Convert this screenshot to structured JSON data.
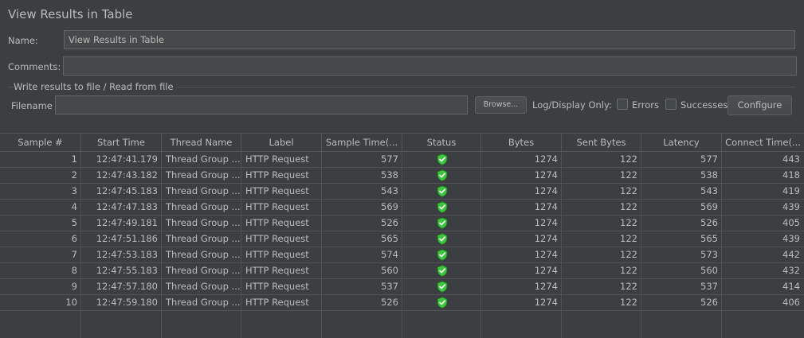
{
  "panel": {
    "title": "View Results in Table",
    "name_label": "Name:",
    "name_value": "View Results in Table",
    "comments_label": "Comments:",
    "comments_value": ""
  },
  "file_group": {
    "title": "Write results to file / Read from file",
    "filename_label": "Filename",
    "filename_value": "",
    "browse_label": "Browse...",
    "log_display_label": "Log/Display Only:",
    "errors_label": "Errors",
    "errors_checked": false,
    "successes_label": "Successes",
    "successes_checked": false,
    "configure_label": "Configure"
  },
  "table": {
    "columns": [
      "Sample #",
      "Start Time",
      "Thread Name",
      "Label",
      "Sample Time(...",
      "Status",
      "Bytes",
      "Sent Bytes",
      "Latency",
      "Connect Time(..."
    ],
    "rows": [
      {
        "sample": "1",
        "start": "12:47:41.179",
        "thread": "Thread Group ...",
        "label": "HTTP Request",
        "sample_time": "577",
        "status": "success",
        "bytes": "1274",
        "sent": "122",
        "latency": "577",
        "connect": "443"
      },
      {
        "sample": "2",
        "start": "12:47:43.182",
        "thread": "Thread Group ...",
        "label": "HTTP Request",
        "sample_time": "538",
        "status": "success",
        "bytes": "1274",
        "sent": "122",
        "latency": "538",
        "connect": "418"
      },
      {
        "sample": "3",
        "start": "12:47:45.183",
        "thread": "Thread Group ...",
        "label": "HTTP Request",
        "sample_time": "543",
        "status": "success",
        "bytes": "1274",
        "sent": "122",
        "latency": "543",
        "connect": "419"
      },
      {
        "sample": "4",
        "start": "12:47:47.183",
        "thread": "Thread Group ...",
        "label": "HTTP Request",
        "sample_time": "569",
        "status": "success",
        "bytes": "1274",
        "sent": "122",
        "latency": "569",
        "connect": "439"
      },
      {
        "sample": "5",
        "start": "12:47:49.181",
        "thread": "Thread Group ...",
        "label": "HTTP Request",
        "sample_time": "526",
        "status": "success",
        "bytes": "1274",
        "sent": "122",
        "latency": "526",
        "connect": "405"
      },
      {
        "sample": "6",
        "start": "12:47:51.186",
        "thread": "Thread Group ...",
        "label": "HTTP Request",
        "sample_time": "565",
        "status": "success",
        "bytes": "1274",
        "sent": "122",
        "latency": "565",
        "connect": "439"
      },
      {
        "sample": "7",
        "start": "12:47:53.183",
        "thread": "Thread Group ...",
        "label": "HTTP Request",
        "sample_time": "574",
        "status": "success",
        "bytes": "1274",
        "sent": "122",
        "latency": "573",
        "connect": "442"
      },
      {
        "sample": "8",
        "start": "12:47:55.183",
        "thread": "Thread Group ...",
        "label": "HTTP Request",
        "sample_time": "560",
        "status": "success",
        "bytes": "1274",
        "sent": "122",
        "latency": "560",
        "connect": "432"
      },
      {
        "sample": "9",
        "start": "12:47:57.180",
        "thread": "Thread Group ...",
        "label": "HTTP Request",
        "sample_time": "537",
        "status": "success",
        "bytes": "1274",
        "sent": "122",
        "latency": "537",
        "connect": "414"
      },
      {
        "sample": "10",
        "start": "12:47:59.180",
        "thread": "Thread Group ...",
        "label": "HTTP Request",
        "sample_time": "526",
        "status": "success",
        "bytes": "1274",
        "sent": "122",
        "latency": "526",
        "connect": "406"
      }
    ],
    "status_icon": "shield-check-icon"
  },
  "colors": {
    "background": "#3c3f41",
    "text": "#bbbbbb",
    "success_green": "#3ec43e"
  }
}
